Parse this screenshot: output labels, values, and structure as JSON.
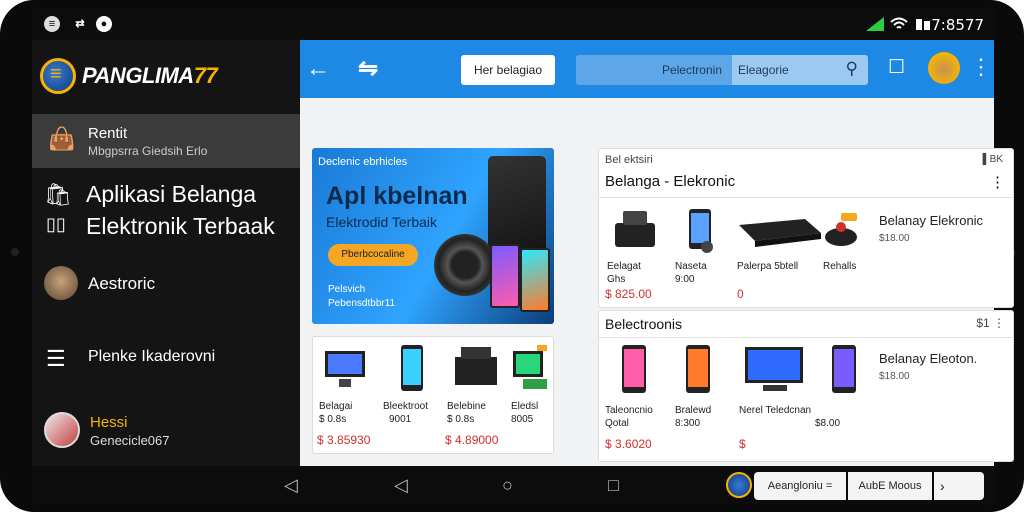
{
  "status_bar": {
    "left_icons": [
      "app-icon",
      "sync-icon",
      "record-icon"
    ],
    "clock": "7:8577"
  },
  "drawer": {
    "brand": {
      "name": "PANGLIMA",
      "number": "77"
    },
    "items": [
      {
        "title": "Rentit",
        "subtitle": "Mbgpsrra Giedsih Erlo"
      },
      {
        "title": "Aplikasi Belanga Elektronik Terbaak"
      },
      {
        "title": "Aestroric"
      },
      {
        "title": "Plenke Ikaderovni"
      },
      {
        "title": "Hessi",
        "subtitle": "Genecicle067"
      }
    ]
  },
  "appbar": {
    "chip": "Her belagiao",
    "search_left": "Pelectronin",
    "search_right": "Eleagorie"
  },
  "banner": {
    "top": "Declenic ebrhicles",
    "title": "Apl kbelnan",
    "subtitle": "Elektrodid Terbaik",
    "button": "Pberbcocaline",
    "foot1": "Pelsvich",
    "foot2": "Pebensdtbbr11"
  },
  "card_top": {
    "small": "Bel ektsiri",
    "right": "▌BK",
    "title": "Belanga - Elekronic",
    "products": [
      {
        "name": "Eelagat",
        "sub": "Ghs",
        "price": "$ 825.00"
      },
      {
        "name": "Naseta",
        "sub": "9:00"
      },
      {
        "name": "Palerpa 5btell",
        "sub": "",
        "price": "0"
      },
      {
        "name": "Rehalls"
      }
    ],
    "side_title": "Belanay Elekronic",
    "side_sub": "$18.00"
  },
  "card_bottom_left": {
    "products": [
      {
        "name": "Belagai",
        "sub": "$ 0.8s"
      },
      {
        "name": "Bleektroot",
        "sub": "9001"
      },
      {
        "name": "Belebine",
        "sub": "$ 0.8s"
      },
      {
        "name": "Eledsl",
        "sub": "8005"
      }
    ],
    "price1": "$ 3.85930",
    "price2": "$ 4.89000"
  },
  "card_bottom_right": {
    "title": "Belectroonis",
    "right": "$1 ⋮",
    "products": [
      {
        "name": "Taleoncnio",
        "sub": "Qotal"
      },
      {
        "name": "Bralewd",
        "sub": "8:300"
      },
      {
        "name": "Nerel Teledcnan",
        "sub": "$8.00"
      }
    ],
    "price": "$ 3.6020",
    "price2": "$",
    "side_title": "Belanay Eleoton.",
    "side_sub": "$18.00"
  },
  "navbar": {
    "chip1": "Aeangloniu =",
    "chip2": "AubE Moous",
    "chip3": "›"
  }
}
